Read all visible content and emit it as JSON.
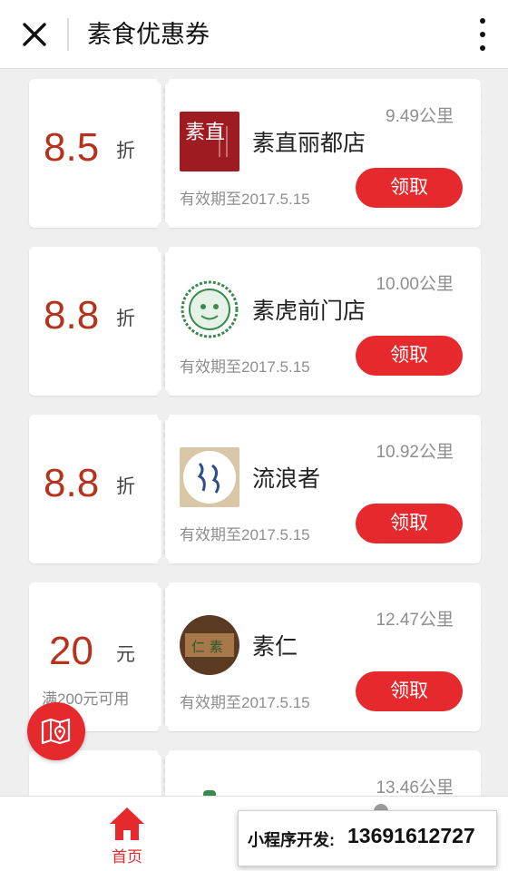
{
  "header": {
    "title": "素食优惠券",
    "close_icon": "close-icon",
    "more_icon": "more-vertical-icon"
  },
  "coupons": [
    {
      "amount": "8.5",
      "unit": "折",
      "condition": "",
      "distance": "9.49公里",
      "store": "素直丽都店",
      "validity": "有效期至2017.5.15",
      "claim": "领取",
      "logo": "suzhi-logo"
    },
    {
      "amount": "8.8",
      "unit": "折",
      "condition": "",
      "distance": "10.00公里",
      "store": "素虎前门店",
      "validity": "有效期至2017.5.15",
      "claim": "领取",
      "logo": "suhu-logo"
    },
    {
      "amount": "8.8",
      "unit": "折",
      "condition": "",
      "distance": "10.92公里",
      "store": "流浪者",
      "validity": "有效期至2017.5.15",
      "claim": "领取",
      "logo": "liulangzhe-logo"
    },
    {
      "amount": "20",
      "unit": "元",
      "condition": "满200元可用",
      "distance": "12.47公里",
      "store": "素仁",
      "validity": "有效期至2017.5.15",
      "claim": "领取",
      "logo": "suren-logo"
    },
    {
      "amount": "",
      "unit": "",
      "condition": "",
      "distance": "13.46公里",
      "store": "",
      "validity": "",
      "claim": "",
      "logo": ""
    }
  ],
  "logo_text": {
    "suzhi": "素直",
    "suren": "仁 素"
  },
  "fab": {
    "icon": "map-location-icon"
  },
  "tabbar": {
    "home_label": "首页",
    "home_icon": "home-icon"
  },
  "banner": {
    "label": "小程序开发:",
    "phone": "13691612727"
  },
  "colors": {
    "accent": "#e5292d",
    "amount": "#b5331c",
    "background": "#efefef"
  }
}
